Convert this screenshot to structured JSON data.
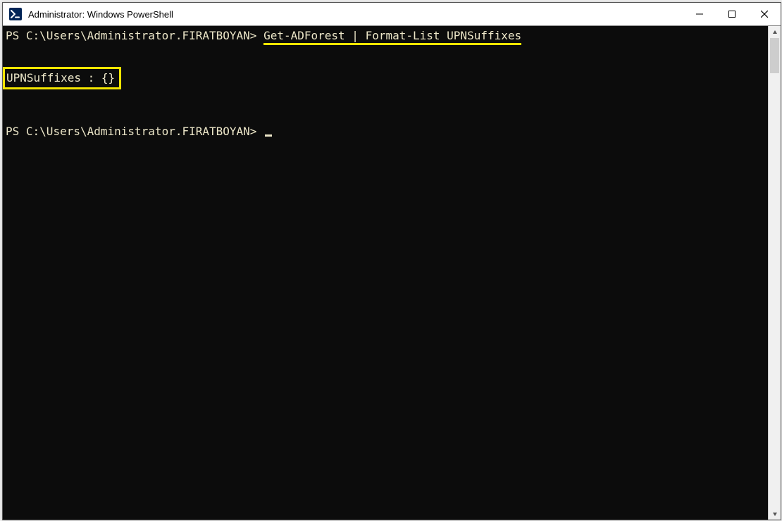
{
  "window": {
    "title": "Administrator: Windows PowerShell"
  },
  "terminal": {
    "prompt_prefix": "PS ",
    "path": "C:\\Users\\Administrator.FIRATBOYAN",
    "prompt_suffix": ">",
    "command": "Get-ADForest | Format-List UPNSuffixes",
    "output_line": "UPNSuffixes : {}"
  },
  "icons": {
    "powershell": "powershell-icon",
    "minimize": "—",
    "maximize": "☐",
    "close": "✕",
    "scroll_up": "▴",
    "scroll_down": "▾"
  },
  "colors": {
    "highlight_yellow": "#f2e500",
    "terminal_bg": "#0c0c0c",
    "terminal_fg": "#ece6c8"
  }
}
